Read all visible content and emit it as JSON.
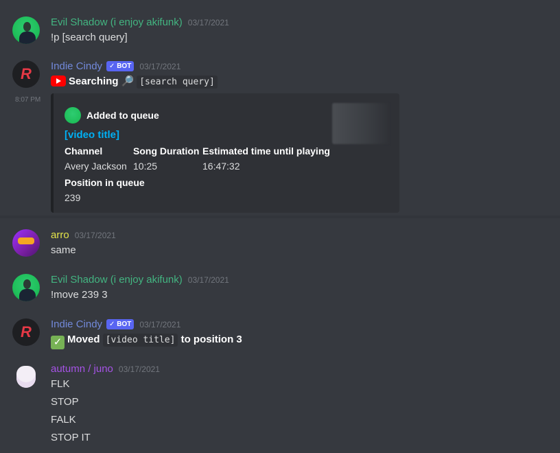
{
  "messages": [
    {
      "author": "Evil Shadow (i enjoy akifunk)",
      "author_color": "#43b581",
      "timestamp": "03/17/2021",
      "lines": [
        "!p [search query]"
      ]
    },
    {
      "author": "Indie Cindy",
      "author_color": "#7289da",
      "badge": "✓ BOT",
      "timestamp": "03/17/2021",
      "searching_label": "Searching",
      "search_query": "[search query]",
      "side_time": "8:07 PM",
      "embed": {
        "author": "Added to queue",
        "title": "[video title]",
        "fields": [
          {
            "name": "Channel",
            "value": "Avery Jackson"
          },
          {
            "name": "Song Duration",
            "value": "10:25"
          },
          {
            "name": "Estimated time until playing",
            "value": "16:47:32"
          },
          {
            "name": "Position in queue",
            "value": "239"
          }
        ]
      }
    },
    {
      "author": "arro",
      "author_color": "#e4e44a",
      "timestamp": "03/17/2021",
      "lines": [
        "same"
      ]
    },
    {
      "author": "Evil Shadow (i enjoy akifunk)",
      "author_color": "#43b581",
      "timestamp": "03/17/2021",
      "lines": [
        "!move 239 3"
      ]
    },
    {
      "author": "Indie Cindy",
      "author_color": "#7289da",
      "badge": "✓ BOT",
      "timestamp": "03/17/2021",
      "moved_label": "Moved",
      "moved_title": "[video title]",
      "moved_suffix": "to position 3"
    },
    {
      "author": "autumn / juno",
      "author_color": "#a653e6",
      "timestamp": "03/17/2021",
      "lines": [
        "FLK",
        "STOP",
        "FALK",
        "STOP IT"
      ]
    }
  ]
}
